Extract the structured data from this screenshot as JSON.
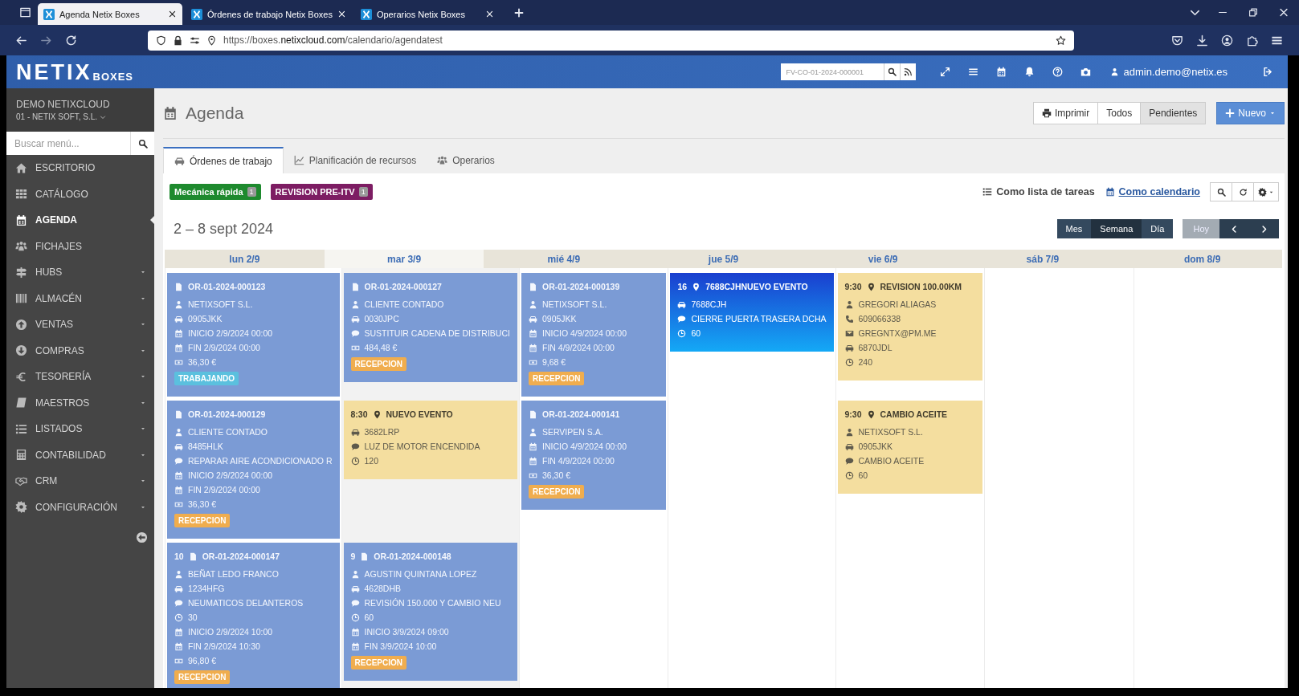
{
  "browser": {
    "tabs": [
      {
        "title": "Agenda Netix Boxes",
        "selected": true
      },
      {
        "title": "Órdenes de trabajo Netix Boxes",
        "selected": false
      },
      {
        "title": "Operarios Netix Boxes",
        "selected": false
      }
    ],
    "url": "https://boxes.**netixcloud.com**/calendario/agendatest"
  },
  "app_header": {
    "logo": "NETIX",
    "logo_sub": "BOXES",
    "search": {
      "placeholder": "FV-CO-01-2024-000001"
    },
    "user": "admin.demo@netix.es"
  },
  "sidebar": {
    "company": "DEMO NETIXCLOUD",
    "branch": "01 - NETIX SOFT, S.L.",
    "search": {
      "placeholder": "Buscar menú..."
    },
    "items": [
      {
        "label": "ESCRITORIO",
        "selected": false,
        "submenu": false
      },
      {
        "label": "CATÁLOGO",
        "selected": false,
        "submenu": false
      },
      {
        "label": "AGENDA",
        "selected": true,
        "submenu": false
      },
      {
        "label": "FICHAJES",
        "selected": false,
        "submenu": false
      },
      {
        "label": "HUBS",
        "selected": false,
        "submenu": true
      },
      {
        "label": "ALMACÉN",
        "selected": false,
        "submenu": true
      },
      {
        "label": "VENTAS",
        "selected": false,
        "submenu": true
      },
      {
        "label": "COMPRAS",
        "selected": false,
        "submenu": true
      },
      {
        "label": "TESORERÍA",
        "selected": false,
        "submenu": true
      },
      {
        "label": "MAESTROS",
        "selected": false,
        "submenu": true
      },
      {
        "label": "LISTADOS",
        "selected": false,
        "submenu": true
      },
      {
        "label": "CONTABILIDAD",
        "selected": false,
        "submenu": true
      },
      {
        "label": "CRM",
        "selected": false,
        "submenu": true
      },
      {
        "label": "CONFIGURACIÓN",
        "selected": false,
        "submenu": true
      }
    ]
  },
  "page": {
    "title": "Agenda",
    "print_button": "Imprimir",
    "filters": [
      {
        "label": "Todos",
        "selected": false
      },
      {
        "label": "Pendientes",
        "selected": true
      }
    ],
    "new_button": "Nuevo",
    "tabs": [
      {
        "label": "Órdenes de trabajo",
        "selected": true
      },
      {
        "label": "Planificación de recursos",
        "selected": false
      },
      {
        "label": "Operarios",
        "selected": false
      }
    ],
    "tags": [
      {
        "label": "Mecánica rápida",
        "count": "1",
        "color": "#1e8a2e"
      },
      {
        "label": "REVISION PRE-ITV",
        "count": "1",
        "color": "#7d1d63"
      }
    ],
    "views": [
      {
        "label": "Como lista de tareas",
        "selected": false
      },
      {
        "label": "Como calendario",
        "selected": true
      }
    ],
    "range": "2 – 8 sept 2024",
    "modes": [
      {
        "label": "Mes",
        "selected": false
      },
      {
        "label": "Semana",
        "selected": true
      },
      {
        "label": "Día",
        "selected": false
      }
    ],
    "today_button": {
      "label": "Hoy",
      "disabled": true
    },
    "days": [
      {
        "label": "lun 2/9",
        "today": false,
        "events": [
          {
            "kind": "order",
            "title": "OR-01-2024-000123",
            "fields": [
              {
                "kind": "client",
                "text": "NETIXSOFT S.L."
              },
              {
                "kind": "vehicle",
                "text": "0905JKK"
              },
              {
                "kind": "start",
                "text": "INICIO 2/9/2024 00:00"
              },
              {
                "kind": "end",
                "text": "FIN 2/9/2024 00:00"
              },
              {
                "kind": "price",
                "text": "36,30 €"
              }
            ],
            "status": {
              "kind": "working",
              "text": "TRABAJANDO"
            }
          },
          {
            "kind": "order",
            "title": "OR-01-2024-000129",
            "fields": [
              {
                "kind": "client",
                "text": "CLIENTE CONTADO"
              },
              {
                "kind": "vehicle",
                "text": "8485HLK"
              },
              {
                "kind": "comment",
                "text": "REPARAR AIRE ACONDICIONADO R"
              },
              {
                "kind": "start",
                "text": "INICIO 2/9/2024 00:00"
              },
              {
                "kind": "end",
                "text": "FIN 2/9/2024 00:00"
              },
              {
                "kind": "price",
                "text": "36,30 €"
              }
            ],
            "status": {
              "kind": "reception",
              "text": "RECEPCION"
            }
          },
          {
            "kind": "order",
            "prefix": "10",
            "title": "OR-01-2024-000147",
            "fields": [
              {
                "kind": "client",
                "text": "BEÑAT LEDO FRANCO"
              },
              {
                "kind": "vehicle",
                "text": "1234HFG"
              },
              {
                "kind": "comment",
                "text": "NEUMATICOS DELANTEROS"
              },
              {
                "kind": "duration",
                "text": "30"
              },
              {
                "kind": "start",
                "text": "INICIO 2/9/2024 10:00"
              },
              {
                "kind": "end",
                "text": "FIN 2/9/2024 10:30"
              },
              {
                "kind": "price",
                "text": "96,80 €"
              }
            ],
            "status": {
              "kind": "reception",
              "text": "RECEPCION"
            }
          }
        ]
      },
      {
        "label": "mar 3/9",
        "today": true,
        "events": [
          {
            "kind": "order",
            "title": "OR-01-2024-000127",
            "fields": [
              {
                "kind": "client",
                "text": "CLIENTE CONTADO"
              },
              {
                "kind": "vehicle",
                "text": "0030JPC"
              },
              {
                "kind": "comment",
                "text": "SUSTITUIR CADENA DE DISTRIBUCI"
              },
              {
                "kind": "price",
                "text": "484,48 €"
              }
            ],
            "status": {
              "kind": "reception",
              "text": "RECEPCION"
            }
          },
          {
            "kind": "event",
            "prefix": "8:30",
            "title": "NUEVO EVENTO",
            "fields": [
              {
                "kind": "vehicle",
                "text": "3682LRP"
              },
              {
                "kind": "comment",
                "text": "LUZ DE MOTOR ENCENDIDA"
              },
              {
                "kind": "duration",
                "text": "120"
              }
            ]
          },
          {
            "kind": "order",
            "prefix": "9",
            "title": "OR-01-2024-000148",
            "fields": [
              {
                "kind": "client",
                "text": "AGUSTIN QUINTANA LOPEZ"
              },
              {
                "kind": "vehicle",
                "text": "4628DHB"
              },
              {
                "kind": "comment",
                "text": "REVISIÓN 150.000 Y CAMBIO NEU"
              },
              {
                "kind": "duration",
                "text": "60"
              },
              {
                "kind": "start",
                "text": "INICIO 3/9/2024 09:00"
              },
              {
                "kind": "end",
                "text": "FIN 3/9/2024 10:00"
              }
            ],
            "status": {
              "kind": "reception",
              "text": "RECEPCION"
            }
          }
        ]
      },
      {
        "label": "mié 4/9",
        "today": false,
        "events": [
          {
            "kind": "order",
            "title": "OR-01-2024-000139",
            "fields": [
              {
                "kind": "client",
                "text": "NETIXSOFT S.L."
              },
              {
                "kind": "vehicle",
                "text": "0905JKK"
              },
              {
                "kind": "start",
                "text": "INICIO 4/9/2024 00:00"
              },
              {
                "kind": "end",
                "text": "FIN 4/9/2024 00:00"
              },
              {
                "kind": "price",
                "text": "9,68 €"
              }
            ],
            "status": {
              "kind": "reception",
              "text": "RECEPCION"
            }
          },
          {
            "kind": "order",
            "title": "OR-01-2024-000141",
            "fields": [
              {
                "kind": "client",
                "text": "SERVIPEN S.A."
              },
              {
                "kind": "start",
                "text": "INICIO 4/9/2024 00:00"
              },
              {
                "kind": "end",
                "text": "FIN 4/9/2024 00:00"
              },
              {
                "kind": "price",
                "text": "36,30 €"
              }
            ],
            "status": {
              "kind": "reception",
              "text": "RECEPCION"
            }
          }
        ]
      },
      {
        "label": "jue 5/9",
        "today": false,
        "events": [
          {
            "kind": "highlighted",
            "prefix": "16",
            "title": "7688CJHNUEVO EVENTO",
            "fields": [
              {
                "kind": "vehicle",
                "text": "7688CJH"
              },
              {
                "kind": "comment",
                "text": "CIERRE PUERTA TRASERA DCHA"
              },
              {
                "kind": "duration",
                "text": "60"
              }
            ]
          }
        ]
      },
      {
        "label": "vie 6/9",
        "today": false,
        "events": [
          {
            "kind": "event",
            "prefix": "9:30",
            "title": "REVISION 100.00KM",
            "fields": [
              {
                "kind": "client",
                "text": "GREGORI ALIAGAS"
              },
              {
                "kind": "phone",
                "text": "609066338"
              },
              {
                "kind": "email",
                "text": "GREGNTX@PM.ME"
              },
              {
                "kind": "vehicle",
                "text": "6870JDL"
              },
              {
                "kind": "duration",
                "text": "240"
              }
            ]
          },
          {
            "kind": "event",
            "prefix": "9:30",
            "title": "CAMBIO ACEITE",
            "fields": [
              {
                "kind": "client",
                "text": "NETIXSOFT S.L."
              },
              {
                "kind": "vehicle",
                "text": "0905JKK"
              },
              {
                "kind": "comment",
                "text": "CAMBIO ACEITE"
              },
              {
                "kind": "duration",
                "text": "60"
              }
            ]
          }
        ]
      },
      {
        "label": "sáb 7/9",
        "today": false
      },
      {
        "label": "dom 8/9",
        "today": false
      }
    ]
  }
}
